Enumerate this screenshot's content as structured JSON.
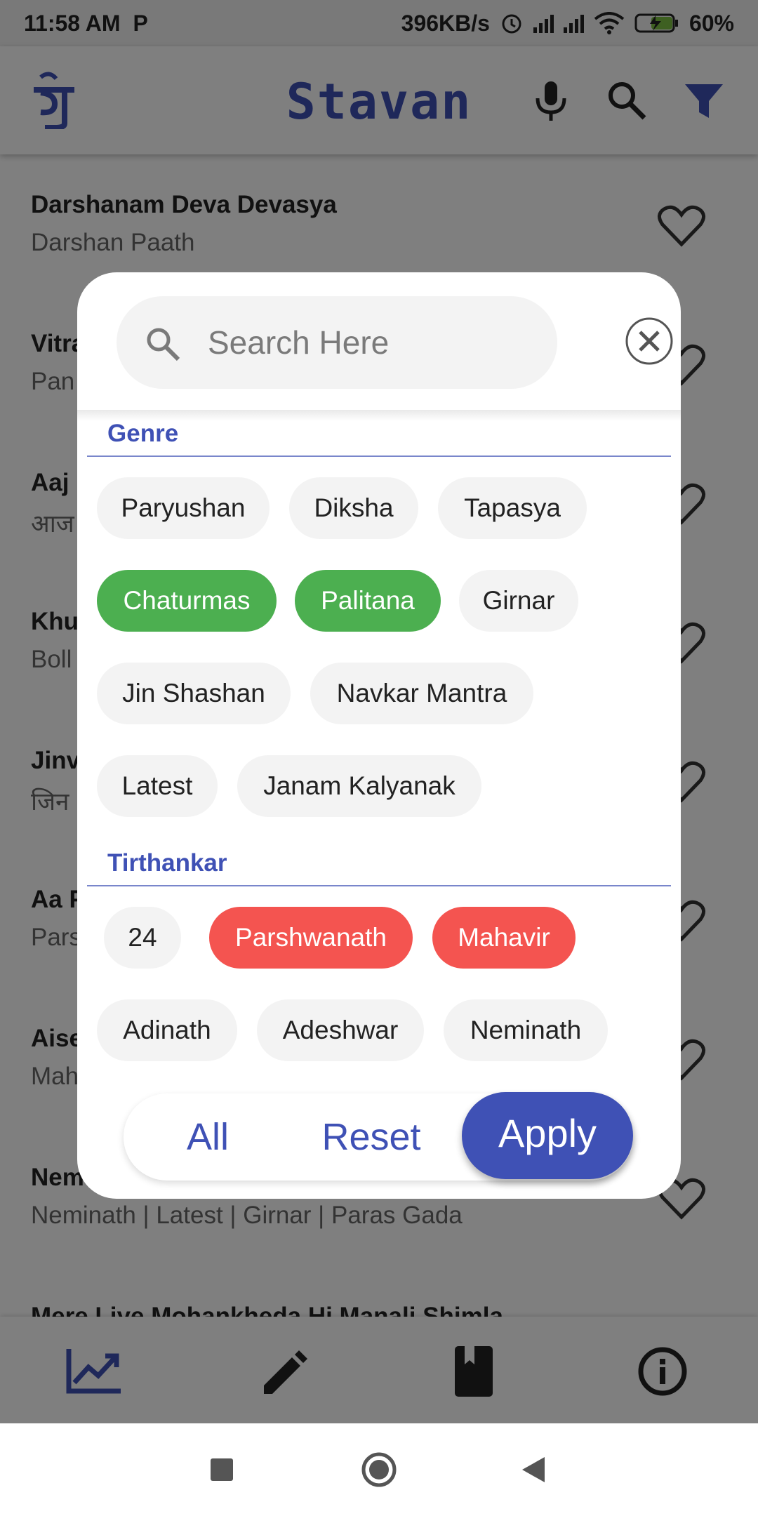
{
  "status_bar": {
    "time": "11:58 AM",
    "app_badge": "P",
    "net_speed": "396KB/s",
    "battery": "60%"
  },
  "app": {
    "title": "Stavan",
    "logo_glyph": "जै"
  },
  "list": [
    {
      "title": "Darshanam Deva Devasya",
      "subtitle": "Darshan Paath"
    },
    {
      "title": "Vitra",
      "subtitle": "Pan"
    },
    {
      "title": "Aaj",
      "subtitle": "आज"
    },
    {
      "title": "Khu",
      "subtitle": "Boll"
    },
    {
      "title": "Jinv",
      "subtitle": "जिन"
    },
    {
      "title": "Aa P",
      "subtitle": "Pars"
    },
    {
      "title": "Aise",
      "subtitle": "Mah"
    },
    {
      "title": "Nem",
      "subtitle": "Neminath | Latest | Girnar | Paras Gada"
    },
    {
      "title": "Mere Liye Mohankheda Hi Manali Shimla",
      "subtitle": ""
    }
  ],
  "filter": {
    "search": {
      "placeholder": "Search Here",
      "value": ""
    },
    "genre_title": "Genre",
    "genre_chips": [
      "Paryushan",
      "Diksha",
      "Tapasya",
      "Chaturmas",
      "Palitana",
      "Girnar",
      "Jin Shashan",
      "Navkar Mantra",
      "Latest",
      "Janam Kalyanak"
    ],
    "genre_selected": [
      "Chaturmas",
      "Palitana"
    ],
    "tirthankar_title": "Tirthankar",
    "tirthankar_chips": [
      "24",
      "Parshwanath",
      "Mahavir",
      "Adinath",
      "Adeshwar",
      "Neminath"
    ],
    "tirthankar_selected": [
      "Parshwanath",
      "Mahavir"
    ],
    "actions": {
      "all": "All",
      "reset": "Reset",
      "apply": "Apply"
    }
  },
  "colors": {
    "primary": "#3f51b5",
    "genre_selected": "#4caf50",
    "tirthankar_selected": "#f45450",
    "chip_bg": "#f3f3f3"
  },
  "icons": {
    "mic": "mic-icon",
    "search": "search-icon",
    "filter": "filter-icon",
    "trending": "trending-icon",
    "edit": "pencil-icon",
    "book": "book-icon",
    "info": "info-icon"
  }
}
